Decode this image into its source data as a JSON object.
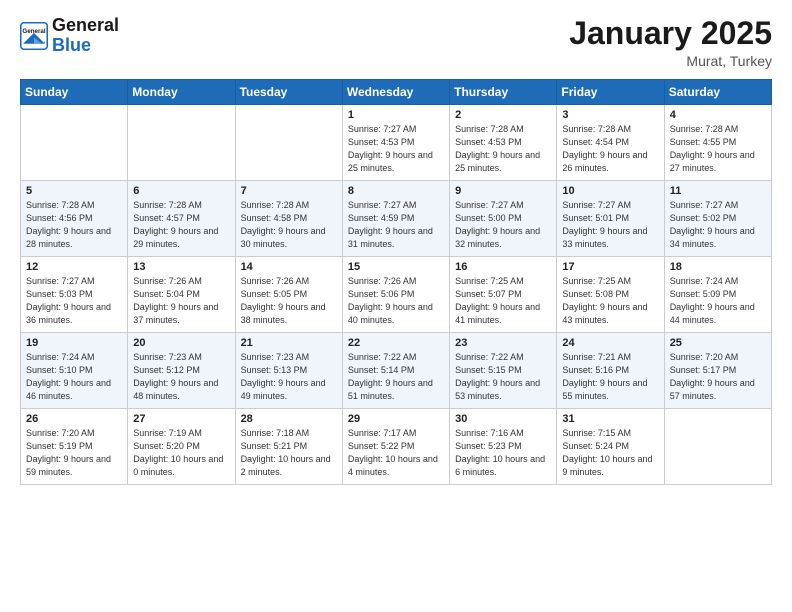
{
  "header": {
    "logo_general": "General",
    "logo_blue": "Blue",
    "month_title": "January 2025",
    "location": "Murat, Turkey"
  },
  "weekdays": [
    "Sunday",
    "Monday",
    "Tuesday",
    "Wednesday",
    "Thursday",
    "Friday",
    "Saturday"
  ],
  "weeks": [
    [
      {
        "day": "",
        "sunrise": "",
        "sunset": "",
        "daylight": ""
      },
      {
        "day": "",
        "sunrise": "",
        "sunset": "",
        "daylight": ""
      },
      {
        "day": "",
        "sunrise": "",
        "sunset": "",
        "daylight": ""
      },
      {
        "day": "1",
        "sunrise": "7:27 AM",
        "sunset": "4:53 PM",
        "daylight": "9 hours and 25 minutes."
      },
      {
        "day": "2",
        "sunrise": "7:28 AM",
        "sunset": "4:53 PM",
        "daylight": "9 hours and 25 minutes."
      },
      {
        "day": "3",
        "sunrise": "7:28 AM",
        "sunset": "4:54 PM",
        "daylight": "9 hours and 26 minutes."
      },
      {
        "day": "4",
        "sunrise": "7:28 AM",
        "sunset": "4:55 PM",
        "daylight": "9 hours and 27 minutes."
      }
    ],
    [
      {
        "day": "5",
        "sunrise": "7:28 AM",
        "sunset": "4:56 PM",
        "daylight": "9 hours and 28 minutes."
      },
      {
        "day": "6",
        "sunrise": "7:28 AM",
        "sunset": "4:57 PM",
        "daylight": "9 hours and 29 minutes."
      },
      {
        "day": "7",
        "sunrise": "7:28 AM",
        "sunset": "4:58 PM",
        "daylight": "9 hours and 30 minutes."
      },
      {
        "day": "8",
        "sunrise": "7:27 AM",
        "sunset": "4:59 PM",
        "daylight": "9 hours and 31 minutes."
      },
      {
        "day": "9",
        "sunrise": "7:27 AM",
        "sunset": "5:00 PM",
        "daylight": "9 hours and 32 minutes."
      },
      {
        "day": "10",
        "sunrise": "7:27 AM",
        "sunset": "5:01 PM",
        "daylight": "9 hours and 33 minutes."
      },
      {
        "day": "11",
        "sunrise": "7:27 AM",
        "sunset": "5:02 PM",
        "daylight": "9 hours and 34 minutes."
      }
    ],
    [
      {
        "day": "12",
        "sunrise": "7:27 AM",
        "sunset": "5:03 PM",
        "daylight": "9 hours and 36 minutes."
      },
      {
        "day": "13",
        "sunrise": "7:26 AM",
        "sunset": "5:04 PM",
        "daylight": "9 hours and 37 minutes."
      },
      {
        "day": "14",
        "sunrise": "7:26 AM",
        "sunset": "5:05 PM",
        "daylight": "9 hours and 38 minutes."
      },
      {
        "day": "15",
        "sunrise": "7:26 AM",
        "sunset": "5:06 PM",
        "daylight": "9 hours and 40 minutes."
      },
      {
        "day": "16",
        "sunrise": "7:25 AM",
        "sunset": "5:07 PM",
        "daylight": "9 hours and 41 minutes."
      },
      {
        "day": "17",
        "sunrise": "7:25 AM",
        "sunset": "5:08 PM",
        "daylight": "9 hours and 43 minutes."
      },
      {
        "day": "18",
        "sunrise": "7:24 AM",
        "sunset": "5:09 PM",
        "daylight": "9 hours and 44 minutes."
      }
    ],
    [
      {
        "day": "19",
        "sunrise": "7:24 AM",
        "sunset": "5:10 PM",
        "daylight": "9 hours and 46 minutes."
      },
      {
        "day": "20",
        "sunrise": "7:23 AM",
        "sunset": "5:12 PM",
        "daylight": "9 hours and 48 minutes."
      },
      {
        "day": "21",
        "sunrise": "7:23 AM",
        "sunset": "5:13 PM",
        "daylight": "9 hours and 49 minutes."
      },
      {
        "day": "22",
        "sunrise": "7:22 AM",
        "sunset": "5:14 PM",
        "daylight": "9 hours and 51 minutes."
      },
      {
        "day": "23",
        "sunrise": "7:22 AM",
        "sunset": "5:15 PM",
        "daylight": "9 hours and 53 minutes."
      },
      {
        "day": "24",
        "sunrise": "7:21 AM",
        "sunset": "5:16 PM",
        "daylight": "9 hours and 55 minutes."
      },
      {
        "day": "25",
        "sunrise": "7:20 AM",
        "sunset": "5:17 PM",
        "daylight": "9 hours and 57 minutes."
      }
    ],
    [
      {
        "day": "26",
        "sunrise": "7:20 AM",
        "sunset": "5:19 PM",
        "daylight": "9 hours and 59 minutes."
      },
      {
        "day": "27",
        "sunrise": "7:19 AM",
        "sunset": "5:20 PM",
        "daylight": "10 hours and 0 minutes."
      },
      {
        "day": "28",
        "sunrise": "7:18 AM",
        "sunset": "5:21 PM",
        "daylight": "10 hours and 2 minutes."
      },
      {
        "day": "29",
        "sunrise": "7:17 AM",
        "sunset": "5:22 PM",
        "daylight": "10 hours and 4 minutes."
      },
      {
        "day": "30",
        "sunrise": "7:16 AM",
        "sunset": "5:23 PM",
        "daylight": "10 hours and 6 minutes."
      },
      {
        "day": "31",
        "sunrise": "7:15 AM",
        "sunset": "5:24 PM",
        "daylight": "10 hours and 9 minutes."
      },
      {
        "day": "",
        "sunrise": "",
        "sunset": "",
        "daylight": ""
      }
    ]
  ],
  "labels": {
    "sunrise": "Sunrise:",
    "sunset": "Sunset:",
    "daylight": "Daylight:"
  }
}
